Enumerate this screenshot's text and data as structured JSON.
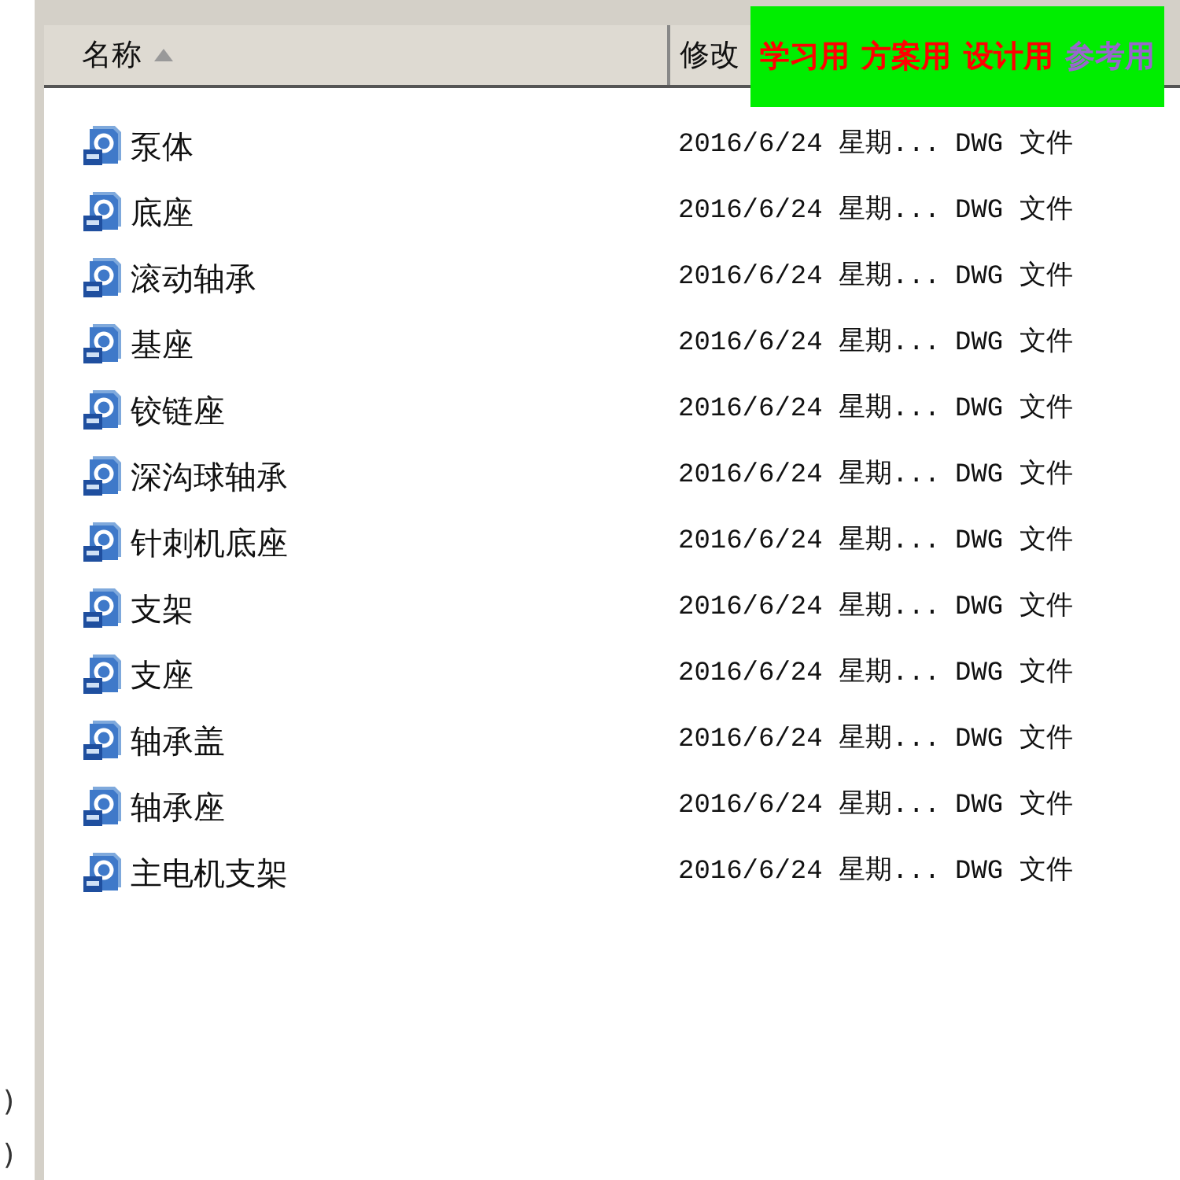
{
  "sidebar": {
    "items": [
      ")",
      ")"
    ]
  },
  "columns": [
    {
      "label": "名称",
      "sorted": true
    },
    {
      "label": "修改"
    }
  ],
  "overlay_banner": [
    {
      "text": "学习用",
      "color": "#ff0000"
    },
    {
      "text": "方案用",
      "color": "#ff0000"
    },
    {
      "text": "设计用",
      "color": "#ff0000"
    },
    {
      "text": "参考用",
      "color": "#9966cc"
    }
  ],
  "files": [
    {
      "name": "泵体",
      "modified": "2016/6/24 星期...",
      "type": "DWG 文件"
    },
    {
      "name": "底座",
      "modified": "2016/6/24 星期...",
      "type": "DWG 文件"
    },
    {
      "name": "滚动轴承",
      "modified": "2016/6/24 星期...",
      "type": "DWG 文件"
    },
    {
      "name": "基座",
      "modified": "2016/6/24 星期...",
      "type": "DWG 文件"
    },
    {
      "name": "铰链座",
      "modified": "2016/6/24 星期...",
      "type": "DWG 文件"
    },
    {
      "name": "深沟球轴承",
      "modified": "2016/6/24 星期...",
      "type": "DWG 文件"
    },
    {
      "name": "针刺机底座",
      "modified": "2016/6/24 星期...",
      "type": "DWG 文件"
    },
    {
      "name": "支架",
      "modified": "2016/6/24 星期...",
      "type": "DWG 文件"
    },
    {
      "name": "支座",
      "modified": "2016/6/24 星期...",
      "type": "DWG 文件"
    },
    {
      "name": "轴承盖",
      "modified": "2016/6/24 星期...",
      "type": "DWG 文件"
    },
    {
      "name": "轴承座",
      "modified": "2016/6/24 星期...",
      "type": "DWG 文件"
    },
    {
      "name": "主电机支架",
      "modified": "2016/6/24 星期...",
      "type": "DWG 文件"
    }
  ]
}
